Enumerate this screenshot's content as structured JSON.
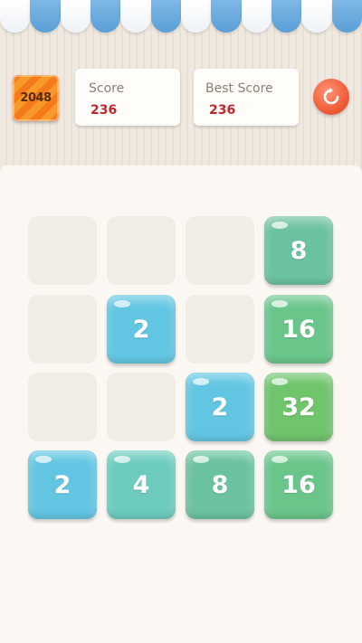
{
  "header": {
    "logo_text": "2048",
    "score_label": "Score",
    "score_value": "236",
    "best_label": "Best Score",
    "best_value": "236"
  },
  "colors": {
    "t2": "#62c6e2",
    "t4": "#6ccbbd",
    "t8": "#6bc2a0",
    "t16": "#6ac58b",
    "t32": "#6fc46c"
  },
  "board": [
    [
      "",
      "",
      "",
      "8"
    ],
    [
      "",
      "2",
      "",
      "16"
    ],
    [
      "",
      "",
      "2",
      "32"
    ],
    [
      "2",
      "4",
      "8",
      "16"
    ]
  ]
}
